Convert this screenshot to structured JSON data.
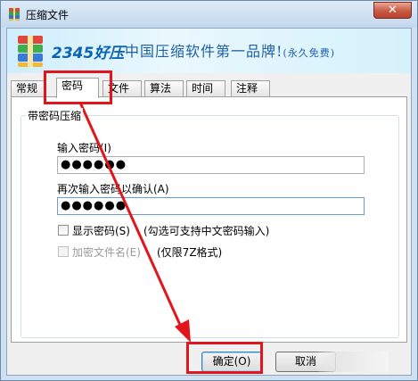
{
  "window": {
    "title": "压缩文件",
    "close_label": "✕"
  },
  "banner": {
    "brand": "2345好压",
    "slogan": "中国压缩软件第一品牌!",
    "slogan_note": "(永久免费)"
  },
  "tabs": [
    "常规",
    "密码",
    "文件",
    "算法",
    "时间",
    "注释"
  ],
  "active_tab": "密码",
  "password_group": {
    "title": "带密码压缩",
    "enter_label": "输入密码(I)",
    "enter_value": "●●●●●●",
    "reenter_label": "再次输入密码以确认(A)",
    "reenter_value": "●●●●●●",
    "show_password_label": "显示密码(S)",
    "show_password_hint": "(勾选可支持中文密码输入)",
    "encrypt_names_label": "加密文件名(E)",
    "encrypt_names_hint": "(仅限7Z格式)"
  },
  "buttons": {
    "ok": "确定(O)",
    "cancel": "取消"
  },
  "colors": {
    "highlight": "#e0161c",
    "brand": "#0b63b8"
  }
}
